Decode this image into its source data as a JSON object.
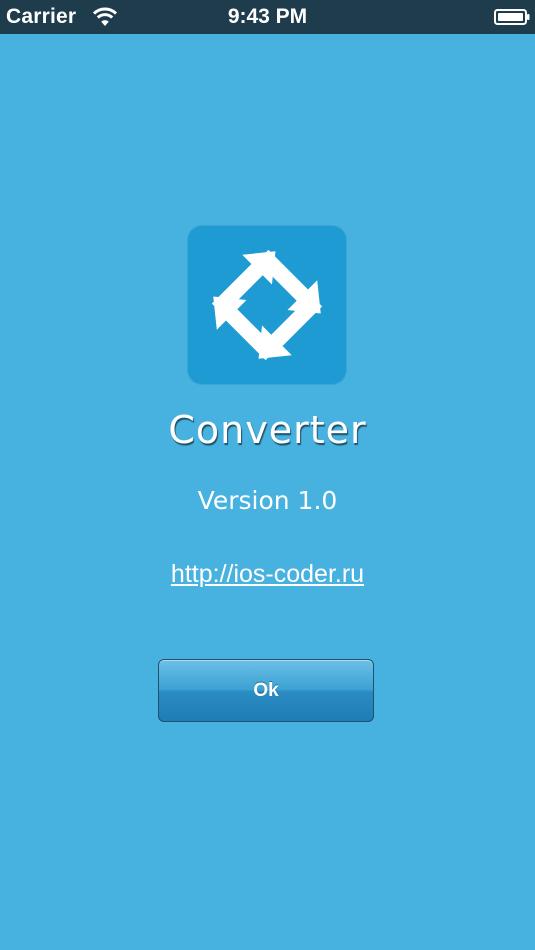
{
  "status_bar": {
    "carrier": "Carrier",
    "time": "9:43 PM",
    "wifi_icon": "wifi-icon",
    "battery_icon": "battery-full-icon"
  },
  "about": {
    "app_icon": "converter-arrows-icon",
    "app_name": "Converter",
    "version": "Version 1.0",
    "link": "http://ios-coder.ru",
    "ok_label": "Ok"
  },
  "colors": {
    "background": "#47b2e0",
    "status_bar": "#1e3c4c",
    "icon_background": "#1f9bd3",
    "button": "#2a8cc2"
  }
}
